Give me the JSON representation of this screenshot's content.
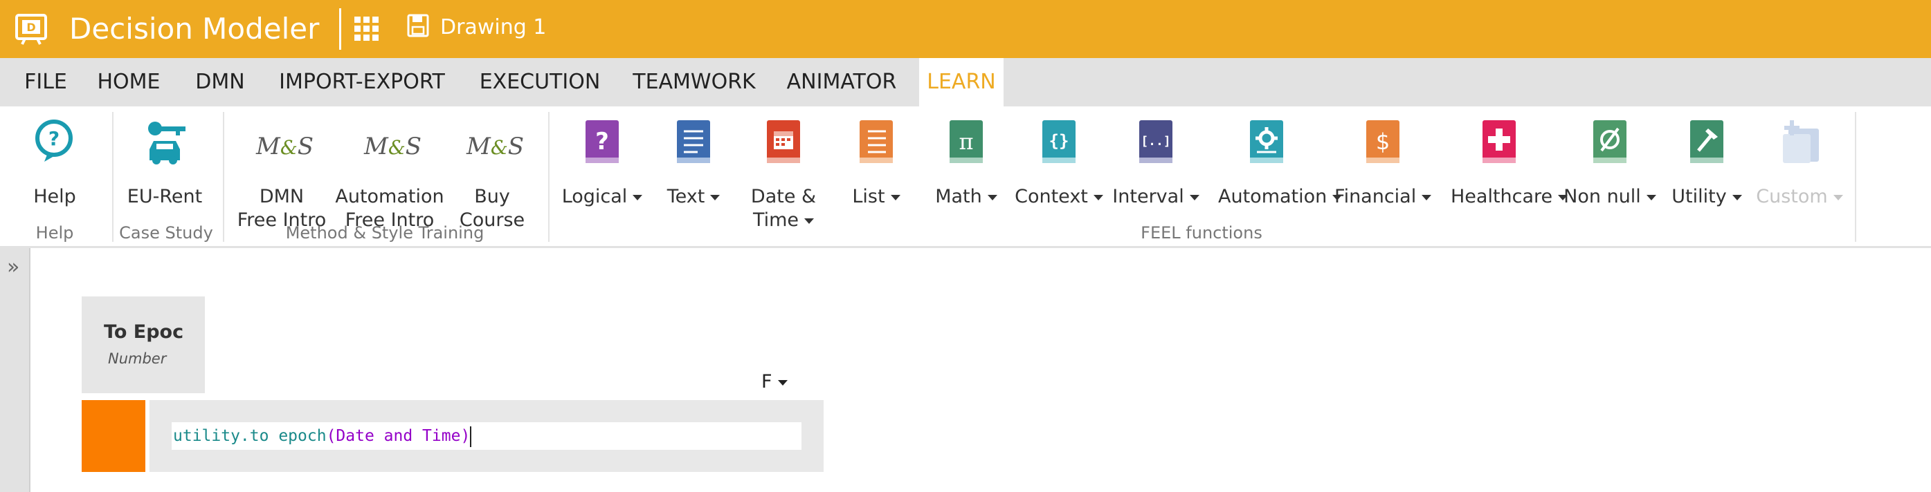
{
  "app": {
    "name": "Decision Modeler",
    "document_name": "Drawing 1"
  },
  "menu": {
    "items": [
      "FILE",
      "HOME",
      "DMN",
      "IMPORT-EXPORT",
      "EXECUTION",
      "TEAMWORK",
      "ANIMATOR",
      "LEARN"
    ],
    "active": "LEARN"
  },
  "ribbon": {
    "groups": {
      "help": "Help",
      "case_study": "Case Study",
      "training": "Method & Style Training",
      "feel": "FEEL functions"
    },
    "help": {
      "label": "Help"
    },
    "eu_rent": {
      "label": "EU-Rent"
    },
    "ms_logo": {
      "left": "M",
      "amp": "&",
      "right": "S"
    },
    "dmn_intro": {
      "line1": "DMN",
      "line2": "Free Intro"
    },
    "automation_intro": {
      "line1": "Automation",
      "line2": "Free Intro"
    },
    "buy_course": {
      "line1": "Buy",
      "line2": "Course"
    },
    "feel": {
      "logical": "Logical",
      "text": "Text",
      "date_time_1": "Date &",
      "date_time_2": "Time",
      "list": "List",
      "math": "Math",
      "context": "Context",
      "interval": "Interval",
      "automation": "Automation",
      "financial": "Financial",
      "healthcare": "Healthcare",
      "non_null": "Non null",
      "utility": "Utility",
      "custom": "Custom"
    },
    "icons": {
      "logical": {
        "color": "#8e44ad",
        "glyph": "?"
      },
      "text": {
        "color": "#3d6cb0",
        "glyph": "≡"
      },
      "date_time": {
        "color": "#d9452b",
        "glyph": "▦"
      },
      "list": {
        "color": "#e8823a",
        "glyph": "☰"
      },
      "math": {
        "color": "#3f8f6b",
        "glyph": "π"
      },
      "context": {
        "color": "#2b9fb0",
        "glyph": "{}"
      },
      "interval": {
        "color": "#4b4f8a",
        "glyph": "[..]"
      },
      "automation": {
        "color": "#2b9fb0",
        "glyph": "⚙"
      },
      "financial": {
        "color": "#e8823a",
        "glyph": "$"
      },
      "healthcare": {
        "color": "#e0205a",
        "glyph": "+"
      },
      "non_null": {
        "color": "#4e9a6a",
        "glyph": "Ø"
      },
      "utility": {
        "color": "#3f8f6b",
        "glyph": "⚒"
      },
      "custom": {
        "color": "#c9d6ea",
        "glyph": "✚"
      }
    }
  },
  "decision": {
    "name": "To Epoc",
    "type": "Number",
    "hit_policy": "F",
    "expression": {
      "fn": "utility.to epoch",
      "open": "(",
      "arg": "Date and Time",
      "close": ")"
    }
  },
  "colors": {
    "accent": "#eeaa22",
    "menubar": "#e2e2e2",
    "orange_block": "#fa7d00"
  }
}
